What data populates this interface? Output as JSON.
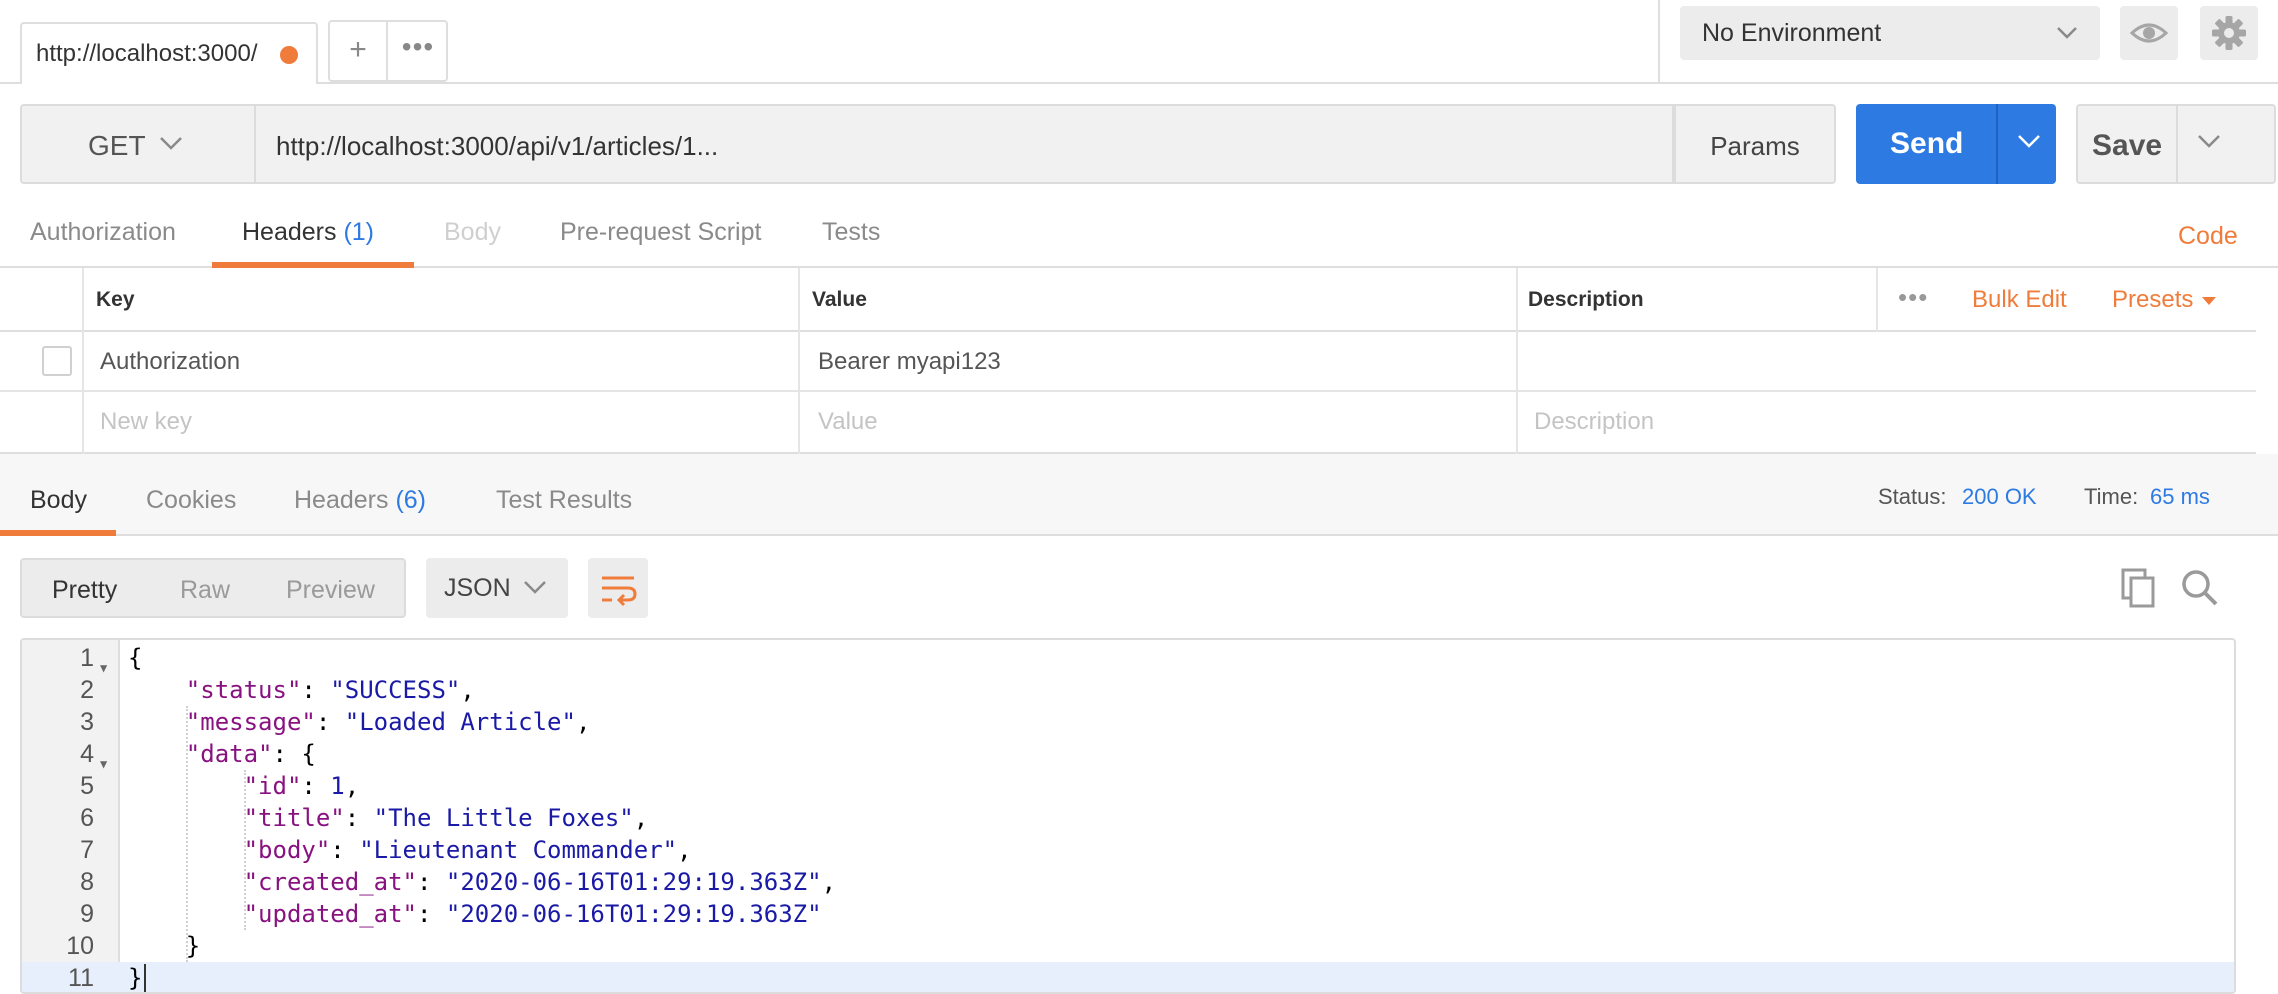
{
  "tab": {
    "url_label": "http://localhost:3000/"
  },
  "environment": {
    "selected": "No Environment"
  },
  "request": {
    "method": "GET",
    "url": "http://localhost:3000/api/v1/articles/1...",
    "params_label": "Params",
    "send_label": "Send",
    "save_label": "Save"
  },
  "request_tabs": {
    "authorization": "Authorization",
    "headers": "Headers",
    "headers_count": "(1)",
    "body": "Body",
    "prerequest": "Pre-request Script",
    "tests": "Tests",
    "code": "Code"
  },
  "headers_table": {
    "col_key": "Key",
    "col_value": "Value",
    "col_description": "Description",
    "bulk_edit": "Bulk Edit",
    "presets": "Presets",
    "rows": [
      {
        "key": "Authorization",
        "value": "Bearer myapi123",
        "description": ""
      }
    ],
    "new_row": {
      "key_placeholder": "New key",
      "value_placeholder": "Value",
      "description_placeholder": "Description"
    }
  },
  "response_tabs": {
    "body": "Body",
    "cookies": "Cookies",
    "headers": "Headers",
    "headers_count": "(6)",
    "test_results": "Test Results",
    "status_label": "Status:",
    "status_value": "200 OK",
    "time_label": "Time:",
    "time_value": "65 ms"
  },
  "response_toolbar": {
    "pretty": "Pretty",
    "raw": "Raw",
    "preview": "Preview",
    "format": "JSON"
  },
  "response_body": {
    "line_numbers": [
      "1",
      "2",
      "3",
      "4",
      "5",
      "6",
      "7",
      "8",
      "9",
      "10",
      "11"
    ],
    "status_key": "\"status\"",
    "status_val": "\"SUCCESS\"",
    "message_key": "\"message\"",
    "message_val": "\"Loaded Article\"",
    "data_key": "\"data\"",
    "id_key": "\"id\"",
    "id_val": "1",
    "title_key": "\"title\"",
    "title_val": "\"The Little Foxes\"",
    "body_key": "\"body\"",
    "body_val": "\"Lieutenant Commander\"",
    "created_key": "\"created_at\"",
    "created_val": "\"2020-06-16T01:29:19.363Z\"",
    "updated_key": "\"updated_at\"",
    "updated_val": "\"2020-06-16T01:29:19.363Z\""
  },
  "colors": {
    "accent": "#f07c3b",
    "primary": "#2d7ae2",
    "json_key": "#881280",
    "json_string": "#1a1aa6"
  }
}
